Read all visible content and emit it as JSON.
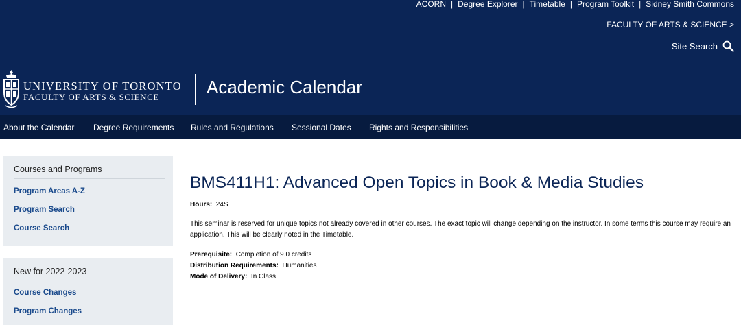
{
  "top_links": [
    "ACORN",
    "Degree Explorer",
    "Timetable",
    "Program Toolkit",
    "Sidney Smith Commons"
  ],
  "faculty_link": "FACULTY OF ARTS & SCIENCE >",
  "site_search": "Site Search",
  "logo": {
    "line1": "UNIVERSITY OF TORONTO",
    "line2": "FACULTY OF ARTS & SCIENCE"
  },
  "app_title": "Academic Calendar",
  "nav": [
    "About the Calendar",
    "Degree Requirements",
    "Rules and Regulations",
    "Sessional Dates",
    "Rights and Responsibilities"
  ],
  "sidebar": {
    "courses_programs": {
      "title": "Courses and Programs",
      "links": [
        "Program Areas A-Z",
        "Program Search",
        "Course Search"
      ]
    },
    "new_section": {
      "title": "New for 2022-2023",
      "links": [
        "Course Changes",
        "Program Changes"
      ]
    }
  },
  "course": {
    "title": "BMS411H1: Advanced Open Topics in Book & Media Studies",
    "hours_label": "Hours:",
    "hours_value": "24S",
    "description": "This seminar is reserved for unique topics not already covered in other courses. The exact topic will change depending on the instructor. In some terms this course may require an application. This will be clearly noted in the Timetable.",
    "prerequisite_label": "Prerequisite:",
    "prerequisite_value": "Completion of 9.0 credits",
    "distribution_label": "Distribution Requirements:",
    "distribution_value": "Humanities",
    "delivery_label": "Mode of Delivery:",
    "delivery_value": "In Class"
  },
  "colors": {
    "header": "#0b2556",
    "nav": "#071b3f",
    "sidebar": "#e9edf1",
    "link": "#1a4a8c"
  }
}
